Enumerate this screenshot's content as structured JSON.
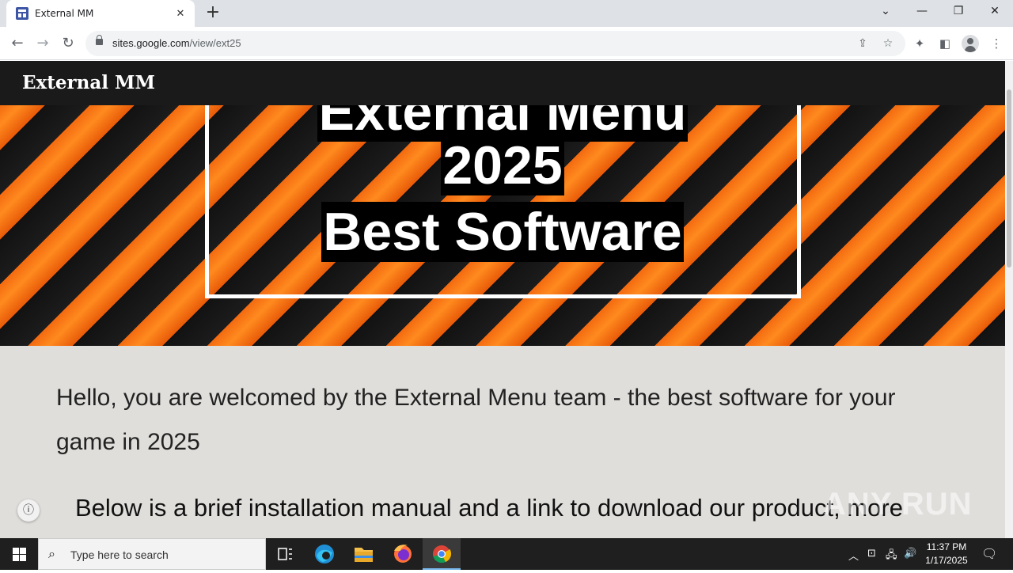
{
  "browser": {
    "tab_title": "External MM",
    "url_host": "sites.google.com",
    "url_path": "/view/ext25"
  },
  "site": {
    "header_title": "External MM",
    "hero": {
      "line1": "External Menu",
      "line2": "2025",
      "line3": "Best Software"
    },
    "intro_text": "Hello, you are welcomed by the External Menu team - the best software for your game in 2025",
    "manual_text": "Below is a brief installation manual and a link to download our product, more"
  },
  "watermark": "ANY RUN",
  "taskbar": {
    "search_placeholder": "Type here to search",
    "time": "11:37 PM",
    "date": "1/17/2025"
  },
  "colors": {
    "header_bg": "#1a1a1a",
    "stripe_orange": "#f36a10",
    "stripe_black": "#121212",
    "content_bg": "#e0dedb"
  }
}
